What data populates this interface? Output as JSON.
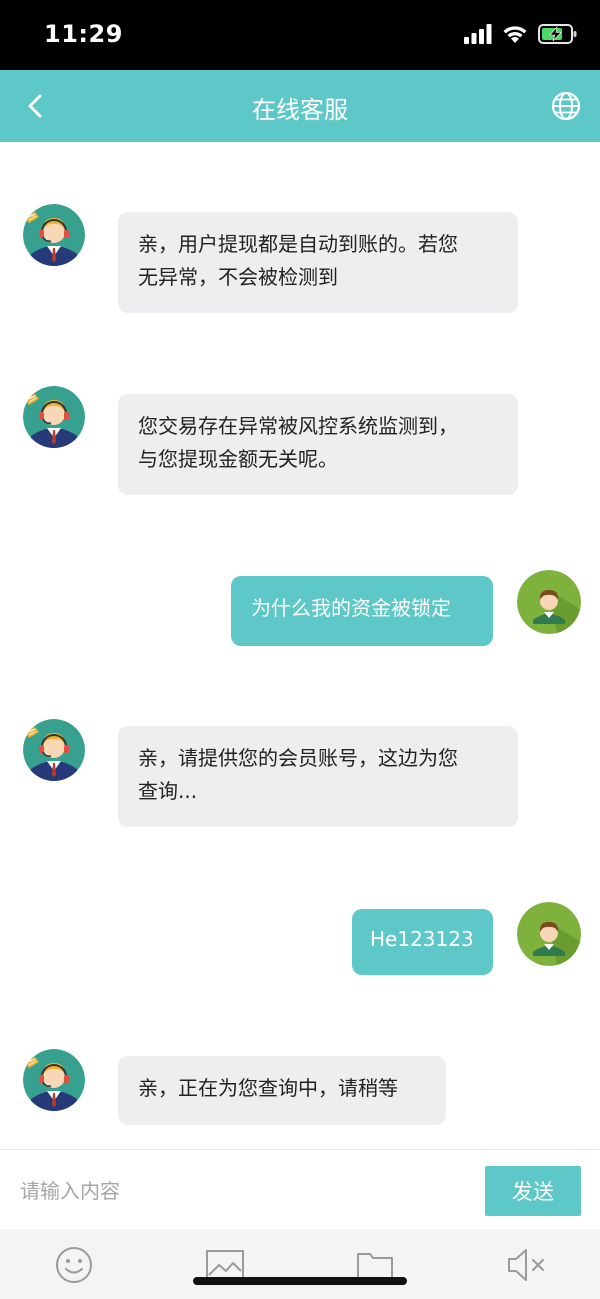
{
  "status_bar": {
    "time": "11:29"
  },
  "nav": {
    "title": "在线客服",
    "back_icon": "chevron-left-icon",
    "globe_icon": "globe-icon"
  },
  "messages": [
    {
      "from": "agent",
      "lines": [
        "亲，用户提现都是自动到账的。若您",
        "无异常，不会被检测到"
      ]
    },
    {
      "from": "agent",
      "lines": [
        "您交易存在异常被风控系统监测到，",
        "与您提现金额无关呢。"
      ]
    },
    {
      "from": "user",
      "lines": [
        "为什么我的资金被锁定"
      ]
    },
    {
      "from": "agent",
      "lines": [
        "亲，请提供您的会员账号，这边为您",
        "查询..."
      ]
    },
    {
      "from": "user",
      "lines": [
        "He123123"
      ]
    },
    {
      "from": "agent",
      "lines": [
        "亲，正在为您查询中，请稍等"
      ]
    }
  ],
  "input": {
    "placeholder": "请输入内容",
    "value": "",
    "send_label": "发送"
  },
  "tools": [
    "emoji-icon",
    "image-icon",
    "folder-icon",
    "speaker-muted-icon"
  ],
  "colors": {
    "accent": "#5ec8c8",
    "agent_bubble": "#eceef0",
    "toolbar_bg": "#f3f4f6"
  }
}
